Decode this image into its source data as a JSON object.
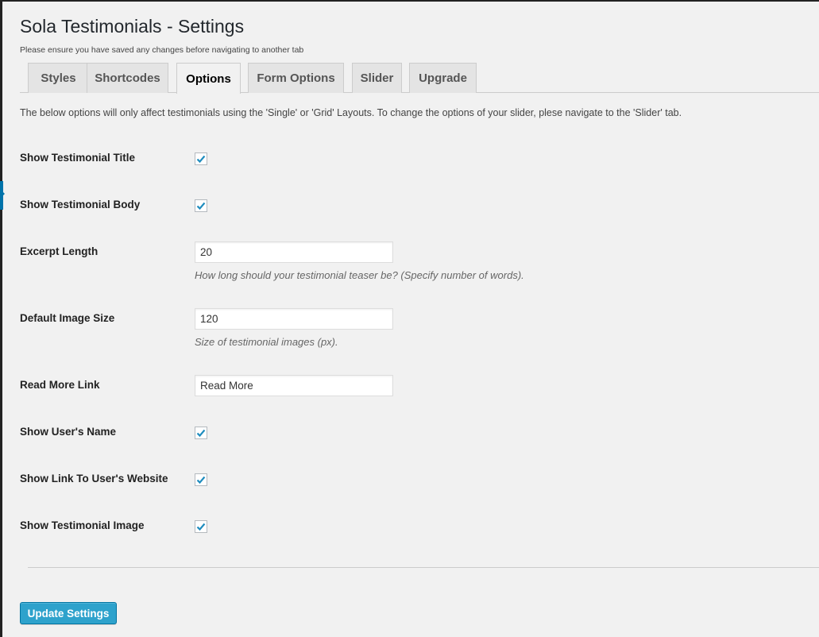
{
  "header": {
    "title": "Sola Testimonials - Settings",
    "notice": "Please ensure you have saved any changes before navigating to another tab"
  },
  "tabs": [
    {
      "label": "Styles",
      "active": false
    },
    {
      "label": "Shortcodes",
      "active": false
    },
    {
      "label": "Options",
      "active": true
    },
    {
      "label": "Form Options",
      "active": false
    },
    {
      "label": "Slider",
      "active": false
    },
    {
      "label": "Upgrade",
      "active": false
    }
  ],
  "intro": "The below options will only affect testimonials using the 'Single' or 'Grid' Layouts. To change the options of your slider, plese navigate to the 'Slider' tab.",
  "options": {
    "show_title": {
      "label": "Show Testimonial Title",
      "checked": true
    },
    "show_body": {
      "label": "Show Testimonial Body",
      "checked": true
    },
    "excerpt_length": {
      "label": "Excerpt Length",
      "value": "20",
      "description": "How long should your testimonial teaser be? (Specify number of words)."
    },
    "image_size": {
      "label": "Default Image Size",
      "value": "120",
      "description": "Size of testimonial images (px)."
    },
    "read_more": {
      "label": "Read More Link",
      "value": "Read More"
    },
    "show_name": {
      "label": "Show User's Name",
      "checked": true
    },
    "show_website": {
      "label": "Show Link To User's Website",
      "checked": true
    },
    "show_image": {
      "label": "Show Testimonial Image",
      "checked": true
    }
  },
  "actions": {
    "submit_label": "Update Settings"
  },
  "colors": {
    "accent": "#2ea2cc",
    "checkmark": "#1e8cbe",
    "background": "#f1f1f1"
  }
}
